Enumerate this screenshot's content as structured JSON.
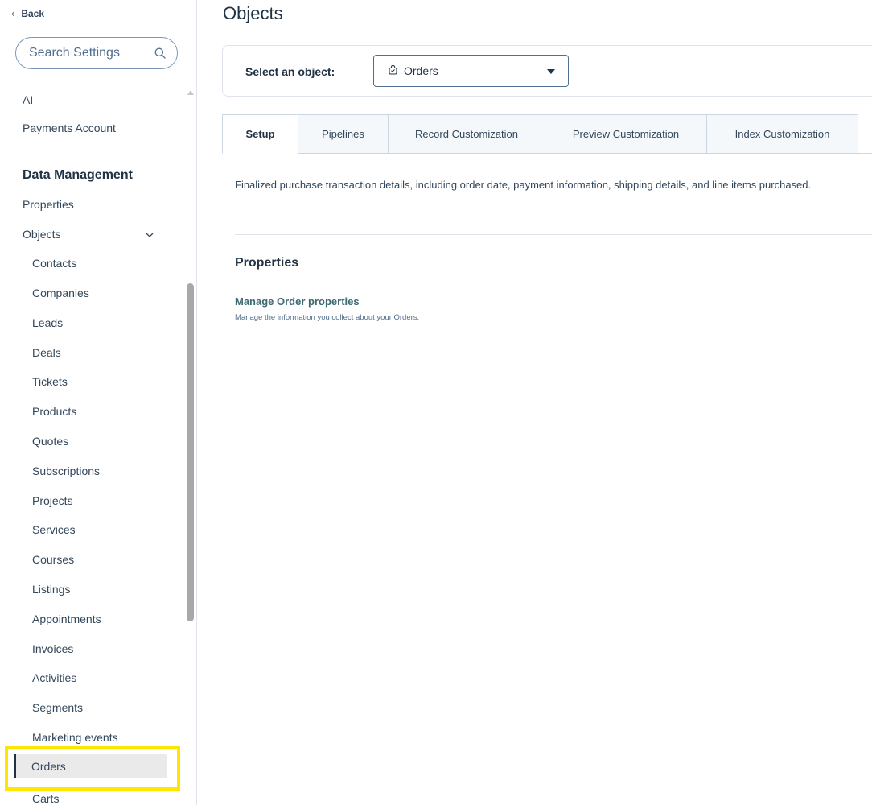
{
  "sidebar": {
    "back_label": "Back",
    "search_placeholder": "Search Settings",
    "items_top": [
      {
        "label": "AI"
      },
      {
        "label": "Payments Account"
      }
    ],
    "section_heading": "Data Management",
    "properties_label": "Properties",
    "objects_label": "Objects",
    "sub_items": [
      {
        "label": "Contacts"
      },
      {
        "label": "Companies"
      },
      {
        "label": "Leads"
      },
      {
        "label": "Deals"
      },
      {
        "label": "Tickets"
      },
      {
        "label": "Products"
      },
      {
        "label": "Quotes"
      },
      {
        "label": "Subscriptions"
      },
      {
        "label": "Projects"
      },
      {
        "label": "Services"
      },
      {
        "label": "Courses"
      },
      {
        "label": "Listings"
      },
      {
        "label": "Appointments"
      },
      {
        "label": "Invoices"
      },
      {
        "label": "Activities"
      },
      {
        "label": "Segments"
      },
      {
        "label": "Marketing events"
      },
      {
        "label": "Orders"
      },
      {
        "label": "Carts"
      }
    ],
    "selected_item": "Orders",
    "highlight_color": "#ffe600"
  },
  "main": {
    "title": "Objects",
    "select_label": "Select an object:",
    "selected_object": "Orders",
    "tabs": [
      {
        "label": "Setup",
        "active": true
      },
      {
        "label": "Pipelines",
        "active": false
      },
      {
        "label": "Record Customization",
        "active": false
      },
      {
        "label": "Preview Customization",
        "active": false
      },
      {
        "label": "Index Customization",
        "active": false
      }
    ],
    "description": "Finalized purchase transaction details, including order date, payment information, shipping details, and line items purchased.",
    "section_title": "Properties",
    "manage_link": "Manage Order properties",
    "manage_subtext": "Manage the information you collect about your Orders."
  },
  "colors": {
    "text": "#33475b",
    "heading": "#213343",
    "link": "#3d6971",
    "border": "#dfe3eb"
  }
}
